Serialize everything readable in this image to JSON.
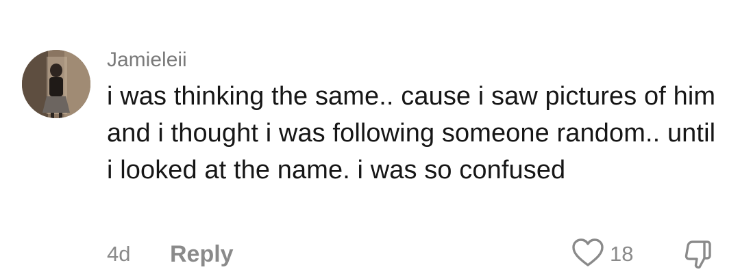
{
  "comment": {
    "username": "Jamieleii",
    "text": "i was thinking the same.. cause i saw pictures of him and i thought i was following someone random.. until i looked at the name. i was so confused",
    "timestamp": "4d",
    "reply_label": "Reply",
    "like_count": "18",
    "avatar_icon": "user-avatar-photo",
    "like_icon": "heart-outline",
    "dislike_icon": "thumbs-down-outline"
  },
  "colors": {
    "text": "#161616",
    "muted": "#8a8a8a",
    "background": "#ffffff"
  }
}
